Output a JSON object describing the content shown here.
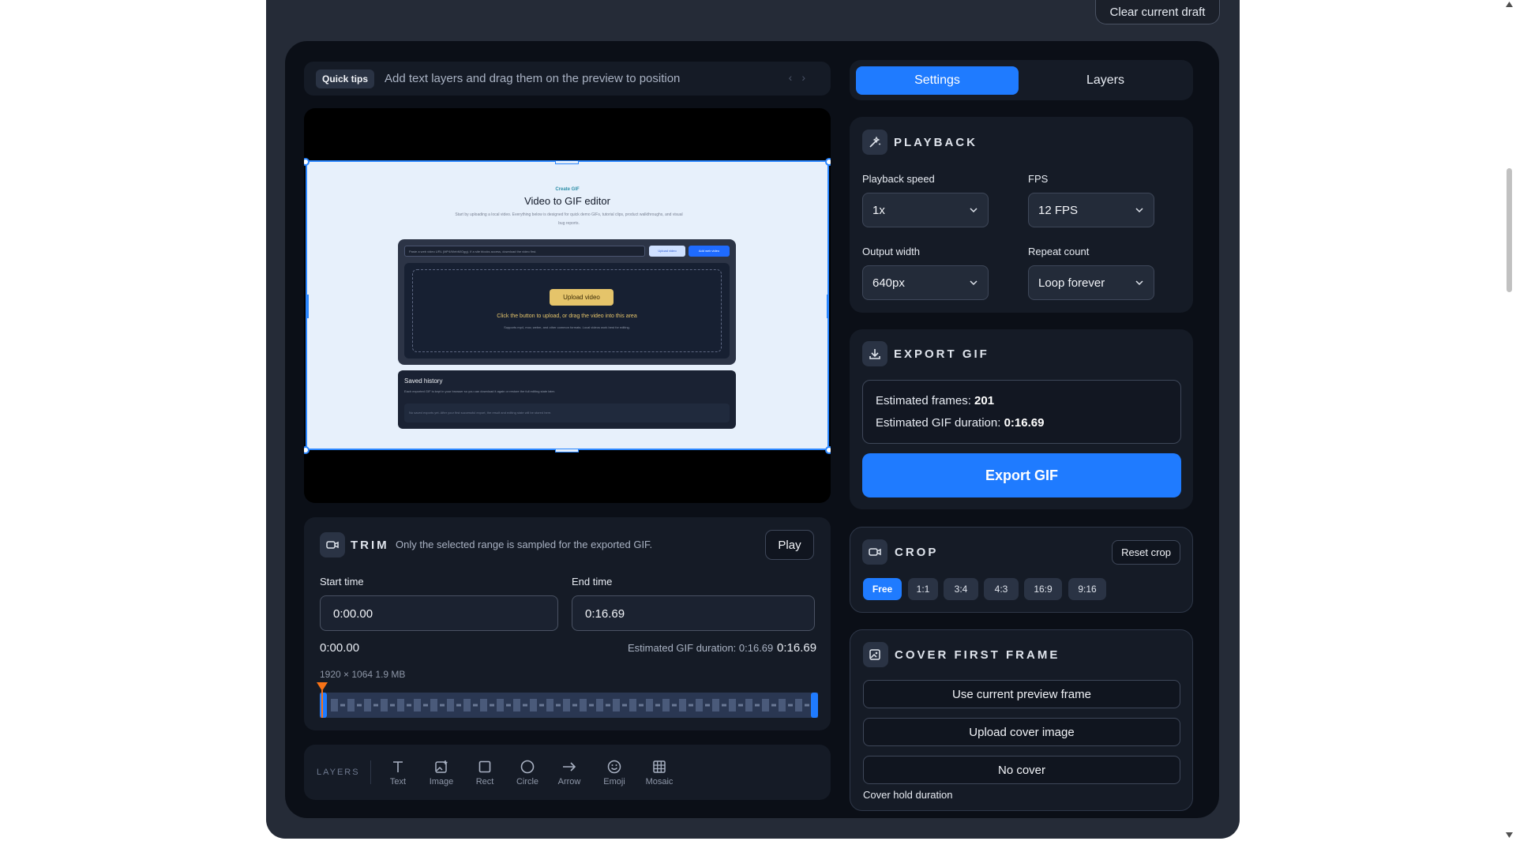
{
  "header": {
    "clear_draft": "Clear current draft"
  },
  "tips": {
    "badge": "Quick tips",
    "text": "Add text layers and drag them on the preview to position",
    "prev": "‹",
    "next": "›"
  },
  "preview": {
    "kicker": "Create GIF",
    "title": "Video to GIF editor",
    "subtitle": "Start by uploading a local video. Everything below is designed for quick demo GIFs, tutorial clips, product walkthroughs, and visual bug reports.",
    "url_placeholder": "Paste a web video URL (MP4/WebM/Ogg). If a site blocks access, download the video first.",
    "upload_video_btn": "Upload video",
    "add_web_video_btn": "Add web video",
    "drop_button": "Upload video",
    "drop_text": "Click the button to upload, or drag the video into this area",
    "drop_hint": "Supports mp4, mov, webm, and other common formats. Local videos work best for editing.",
    "history_title": "Saved history",
    "history_sub": "Each exported GIF is kept in your browser so you can download it again or restore the full editing state later.",
    "history_empty": "No saved exports yet. After your first successful export, the result and editing state will be stored here."
  },
  "tabs": [
    {
      "label": "Settings",
      "active": true
    },
    {
      "label": "Layers",
      "active": false
    }
  ],
  "playback": {
    "title": "PLAYBACK",
    "speed_label": "Playback speed",
    "speed_value": "1x",
    "fps_label": "FPS",
    "fps_value": "12 FPS",
    "width_label": "Output width",
    "width_value": "640px",
    "repeat_label": "Repeat count",
    "repeat_value": "Loop forever"
  },
  "export": {
    "title": "EXPORT GIF",
    "frames_label": "Estimated frames:",
    "frames_value": "201",
    "duration_label": "Estimated GIF duration:",
    "duration_value": "0:16.69",
    "button": "Export GIF"
  },
  "crop": {
    "title": "CROP",
    "reset": "Reset crop",
    "ratios": [
      "Free",
      "1:1",
      "3:4",
      "4:3",
      "16:9",
      "9:16"
    ],
    "active_ratio": "Free"
  },
  "cover": {
    "title": "COVER FIRST FRAME",
    "use_current": "Use current preview frame",
    "upload": "Upload cover image",
    "none": "No cover",
    "hold_label": "Cover hold duration"
  },
  "trim": {
    "title": "TRIM",
    "description": "Only the selected range is sampled for the exported GIF.",
    "play": "Play",
    "start_label": "Start time",
    "start_value": "0:00.00",
    "end_label": "End time",
    "end_value": "0:16.69",
    "current_time": "0:00.00",
    "estimated": "Estimated GIF duration: 0:16.69",
    "total": "0:16.69",
    "meta": "1920 × 1064 1.9 MB"
  },
  "layers_bar": {
    "title": "LAYERS",
    "tools": [
      "Text",
      "Image",
      "Rect",
      "Circle",
      "Arrow",
      "Emoji",
      "Mosaic"
    ]
  },
  "colors": {
    "accent": "#1f7bff",
    "panel": "#151b26",
    "bg": "#0b0f17",
    "playhead": "#f97316"
  }
}
